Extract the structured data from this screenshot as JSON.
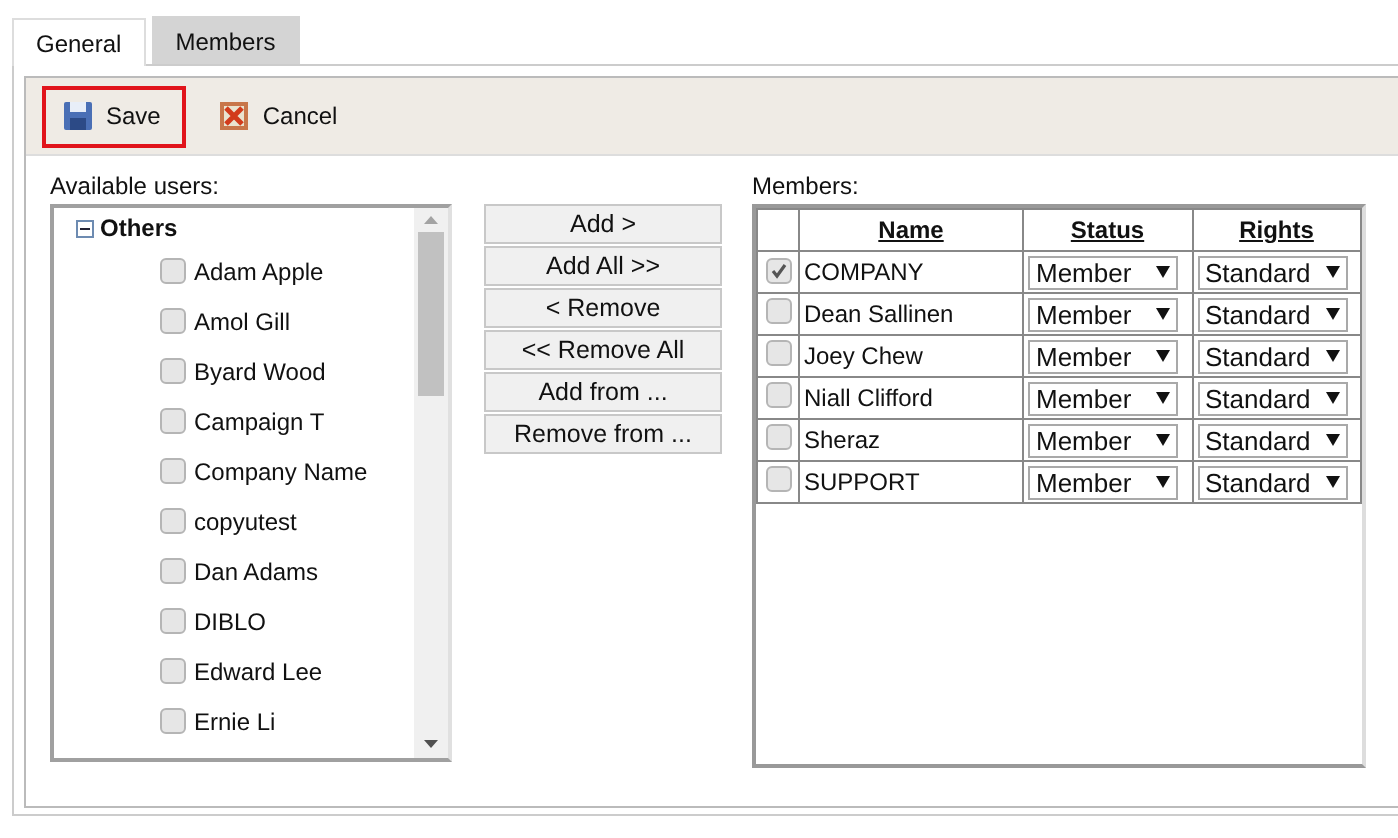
{
  "tabs": [
    {
      "label": "General",
      "selected": true
    },
    {
      "label": "Members",
      "selected": false
    }
  ],
  "toolbar": [
    {
      "label": "Save",
      "kind": "save",
      "highlighted": true
    },
    {
      "label": "Cancel",
      "kind": "cancel",
      "highlighted": false
    }
  ],
  "available_users": {
    "label": "Available users:",
    "group": {
      "label": "Others",
      "expanded": true,
      "children": [
        {
          "label": "Adam Apple",
          "checked": false
        },
        {
          "label": "Amol Gill",
          "checked": false
        },
        {
          "label": "Byard Wood",
          "checked": false
        },
        {
          "label": "Campaign T",
          "checked": false
        },
        {
          "label": "Company Name",
          "checked": false
        },
        {
          "label": "copyutest",
          "checked": false
        },
        {
          "label": "Dan Adams",
          "checked": false
        },
        {
          "label": "DIBLO",
          "checked": false
        },
        {
          "label": "Edward Lee",
          "checked": false
        },
        {
          "label": "Ernie Li",
          "checked": false
        }
      ]
    }
  },
  "actions": [
    "Add >",
    "Add All >>",
    "< Remove",
    "<< Remove All",
    "Add from ...",
    "Remove from ..."
  ],
  "members": {
    "label": "Members:",
    "columns": [
      "Name",
      "Status",
      "Rights"
    ],
    "rows": [
      {
        "checked": true,
        "name": "COMPANY",
        "status": "Member",
        "rights": "Standard"
      },
      {
        "checked": false,
        "name": "Dean Sallinen",
        "status": "Member",
        "rights": "Standard"
      },
      {
        "checked": false,
        "name": "Joey Chew",
        "status": "Member",
        "rights": "Standard"
      },
      {
        "checked": false,
        "name": "Niall Clifford",
        "status": "Member",
        "rights": "Standard"
      },
      {
        "checked": false,
        "name": "Sheraz",
        "status": "Member",
        "rights": "Standard"
      },
      {
        "checked": false,
        "name": "SUPPORT",
        "status": "Member",
        "rights": "Standard"
      }
    ]
  }
}
